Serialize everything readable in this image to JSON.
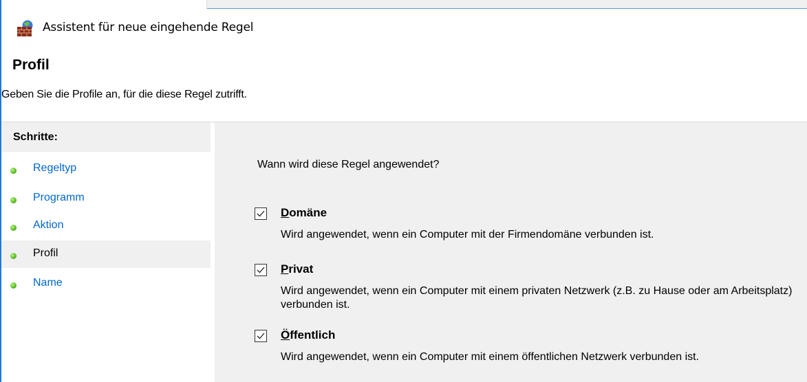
{
  "window": {
    "title": "Assistent für neue eingehende Regel",
    "icon": "firewall-wall-globe-icon"
  },
  "header": {
    "heading": "Profil",
    "subtitle": "Geben Sie die Profile an, für die diese Regel zutrifft."
  },
  "sidebar": {
    "title": "Schritte:",
    "steps": [
      {
        "label": "Regeltyp",
        "active": false
      },
      {
        "label": "Programm",
        "active": false
      },
      {
        "label": "Aktion",
        "active": false
      },
      {
        "label": "Profil",
        "active": true
      },
      {
        "label": "Name",
        "active": false
      }
    ]
  },
  "main": {
    "question": "Wann wird diese Regel angewendet?",
    "options": [
      {
        "accel": "D",
        "rest": "omäne",
        "checked": true,
        "description": "Wird angewendet, wenn ein Computer mit der Firmendomäne verbunden ist."
      },
      {
        "accel": "P",
        "rest": "rivat",
        "checked": true,
        "description": "Wird angewendet, wenn ein Computer mit einem privaten Netzwerk (z.B. zu Hause oder am Arbeitsplatz) verbunden ist."
      },
      {
        "accel": "Ö",
        "rest": "ffentlich",
        "checked": true,
        "description": "Wird angewendet, wenn ein Computer mit einem öffentlichen Netzwerk verbunden ist."
      }
    ]
  },
  "colors": {
    "link": "#0066cc",
    "panel_bg": "#f0f0f0",
    "accent_border": "#1e7ad6",
    "step_dot": "#5fbf2a"
  }
}
